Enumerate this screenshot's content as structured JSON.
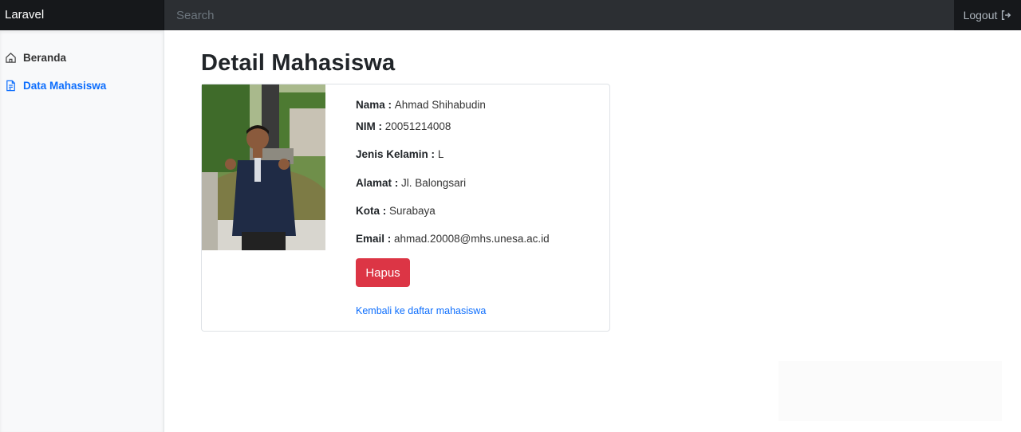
{
  "navbar": {
    "brand": "Laravel",
    "search_placeholder": "Search",
    "logout_label": "Logout"
  },
  "sidebar": {
    "items": [
      {
        "label": "Beranda",
        "icon": "home-icon"
      },
      {
        "label": "Data Mahasiswa",
        "icon": "file-text-icon",
        "active": true
      }
    ]
  },
  "main": {
    "title": "Detail Mahasiswa"
  },
  "student": {
    "name_label": "Nama :",
    "name": "Ahmad Shihabudin",
    "nim_label": "NIM :",
    "nim": "20051214008",
    "gender_label": "Jenis Kelamin :",
    "gender": "L",
    "address_label": "Alamat :",
    "address": "Jl. Balongsari",
    "city_label": "Kota :",
    "city": "Surabaya",
    "email_label": "Email :",
    "email": "ahmad.20008@mhs.unesa.ac.id"
  },
  "actions": {
    "delete_label": "Hapus",
    "back_label": "Kembali ke daftar mahasiswa"
  },
  "colors": {
    "navbar": "#212529",
    "danger": "#dc3545",
    "primary": "#0d6efd"
  }
}
